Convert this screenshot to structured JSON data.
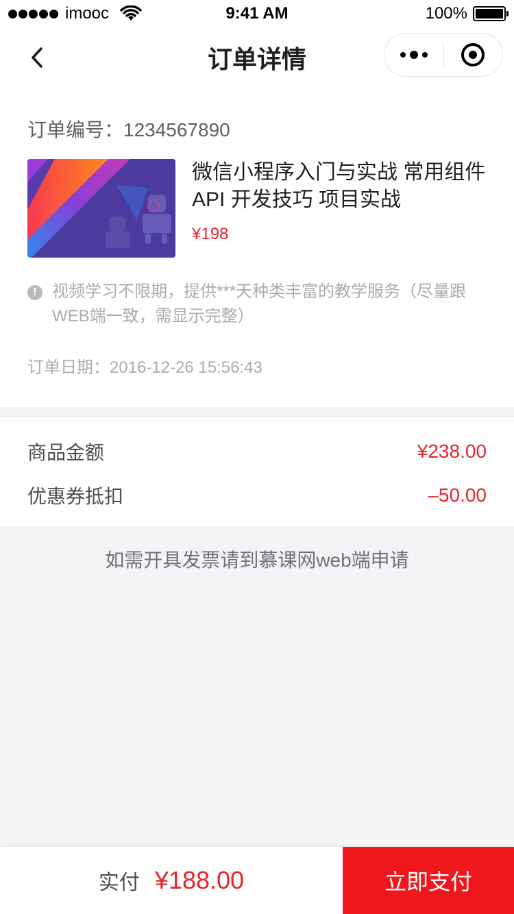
{
  "status_bar": {
    "carrier": "imooc",
    "time": "9:41 AM",
    "battery": "100%"
  },
  "nav": {
    "title": "订单详情",
    "icons": [
      "chevron-left-icon",
      "more-dots-icon",
      "target-icon"
    ]
  },
  "order": {
    "number_label": "订单编号：1234567890",
    "course_title": "微信小程序入门与实战 常用组件API 开发技巧 项目实战",
    "course_price": "¥198",
    "notice": "视频学习不限期，提供***天种类丰富的教学服务（尽量跟WEB端一致，需显示完整）",
    "date_label": "订单日期：2016-12-26   15:56:43"
  },
  "amounts": {
    "goods_label": "商品金额",
    "goods_value": "¥238.00",
    "coupon_label": "优惠券抵扣",
    "coupon_value": "–50.00"
  },
  "invoice_note": "如需开具发票请到慕课网web端申请",
  "bottom": {
    "pay_label": "实付",
    "pay_amount": "¥188.00",
    "pay_button": "立即支付"
  },
  "colors": {
    "accent_red": "#e8242a",
    "button_red": "#f0171c",
    "page_bg": "#f3f4f6"
  }
}
